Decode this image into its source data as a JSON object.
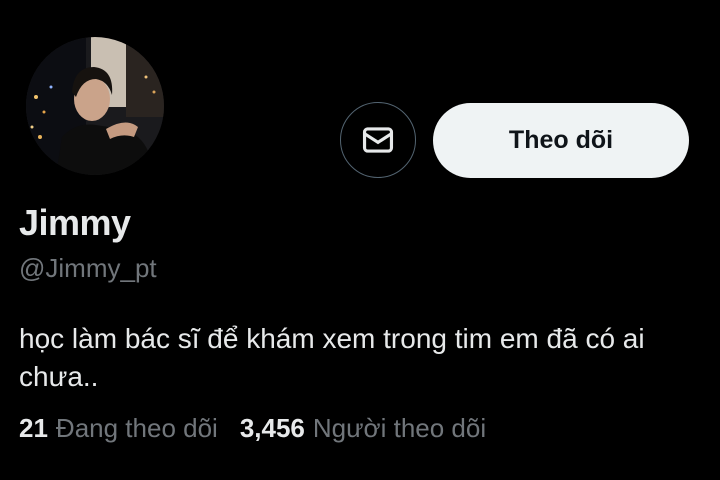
{
  "profile": {
    "display_name": "Jimmy",
    "handle": "@Jimmy_pt",
    "bio": "học làm bác sĩ để khám xem trong tim em đã có ai chưa..",
    "avatar_icon": "profile-photo"
  },
  "actions": {
    "message_icon": "mail-icon",
    "follow_label": "Theo dõi"
  },
  "stats": {
    "following_count": "21",
    "following_label": "Đang theo dõi",
    "followers_count": "3,456",
    "followers_label": "Người theo dõi"
  },
  "colors": {
    "background": "#000000",
    "primary_text": "#e7e9ea",
    "secondary_text": "#71767b",
    "follow_button_bg": "#eff3f4",
    "follow_button_text": "#0f1419",
    "border": "#536471"
  }
}
